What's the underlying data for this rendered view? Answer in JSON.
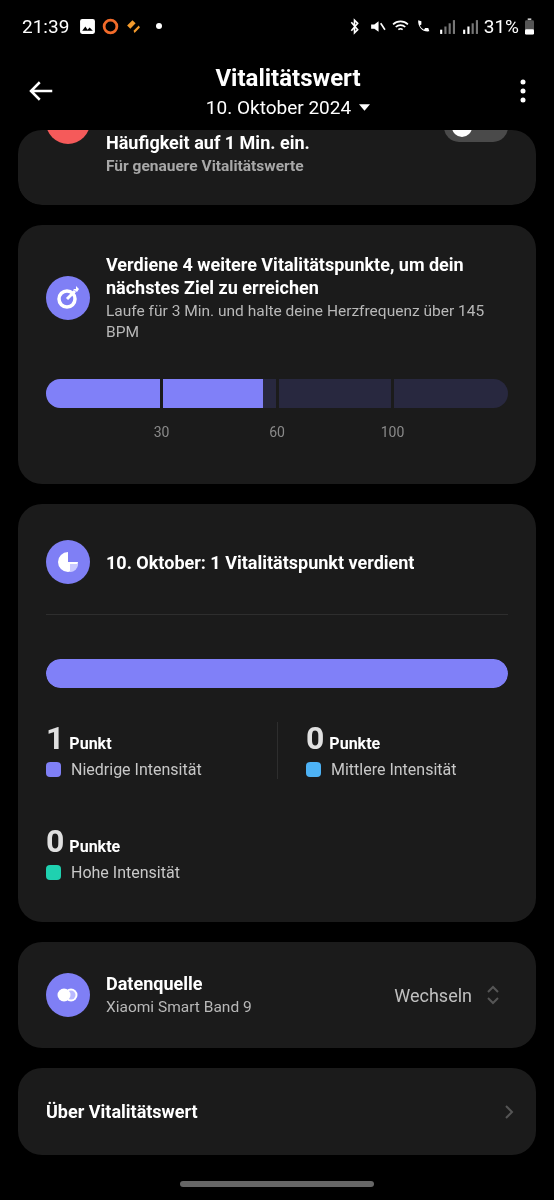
{
  "status_bar": {
    "time": "21:39",
    "battery": "31%"
  },
  "header": {
    "title": "Vitalitätswert",
    "date": "10. Oktober 2024"
  },
  "setting_card": {
    "title": "Häufigkeit auf 1 Min. ein.",
    "subtitle": "Für genauere Vitalitätswerte",
    "toggle": {
      "on": false
    }
  },
  "goal_card": {
    "title": "Verdiene 4 weitere Vitalitätspunkte, um dein nächstes Ziel zu erreichen",
    "subtitle": "Laufe für 3 Min. und halte deine Herzfrequenz über 145 BPM",
    "level": 0.47,
    "ticks": [
      "30",
      "60",
      "100"
    ]
  },
  "day_card": {
    "title": "10. Oktober: 1 Vitalitätspunkt verdient",
    "level": 1,
    "stats": [
      {
        "value": "1",
        "unit": "Punkt",
        "label": "Niedrige Intensität",
        "color": "#7f7ff5"
      },
      {
        "value": "0",
        "unit": "Punkte",
        "label": "Mittlere Intensität",
        "color": "#4db2f5"
      },
      {
        "value": "0",
        "unit": "Punkte",
        "label": "Hohe Intensität",
        "color": "#1fd1b0"
      }
    ]
  },
  "source_card": {
    "title": "Datenquelle",
    "subtitle": "Xiaomi Smart Band 9",
    "action": "Wechseln"
  },
  "about_row": {
    "label": "Über Vitalitätswert"
  }
}
